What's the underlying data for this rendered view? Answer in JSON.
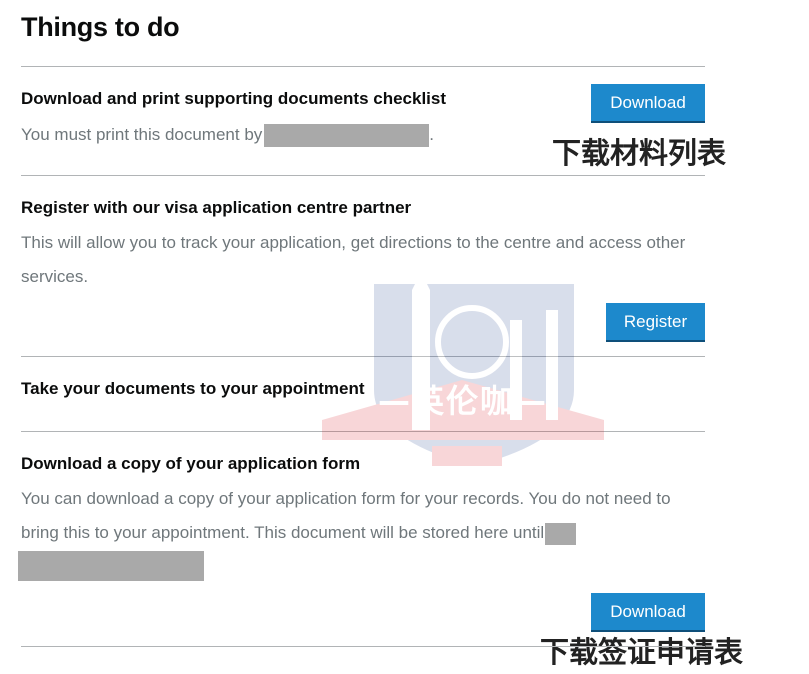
{
  "page": {
    "title": "Things to do"
  },
  "tasks": [
    {
      "heading": "Download and print supporting documents checklist",
      "text": "You must print this document by",
      "text_suffix": ".",
      "button_label": "Download"
    },
    {
      "heading": "Register with our visa application centre partner",
      "text": "This will allow you to track your application, get directions to the centre and access other services.",
      "button_label": "Register"
    },
    {
      "heading": "Take your documents to your appointment"
    },
    {
      "heading": "Download a copy of your application form",
      "text": "You can download a copy of your application form for your records. You do not need to bring this to your appointment. This document will be stored here until",
      "button_label": "Download"
    }
  ],
  "annotations": {
    "download_checklist": "下载材料列表",
    "download_form": "下载签证申请表"
  },
  "watermark": {
    "text": "—英伦咖—"
  },
  "colors": {
    "button": "#1d89cc",
    "muted_text": "#6f777b",
    "divider": "#b1b4b6",
    "redaction": "#a9a9a9"
  }
}
